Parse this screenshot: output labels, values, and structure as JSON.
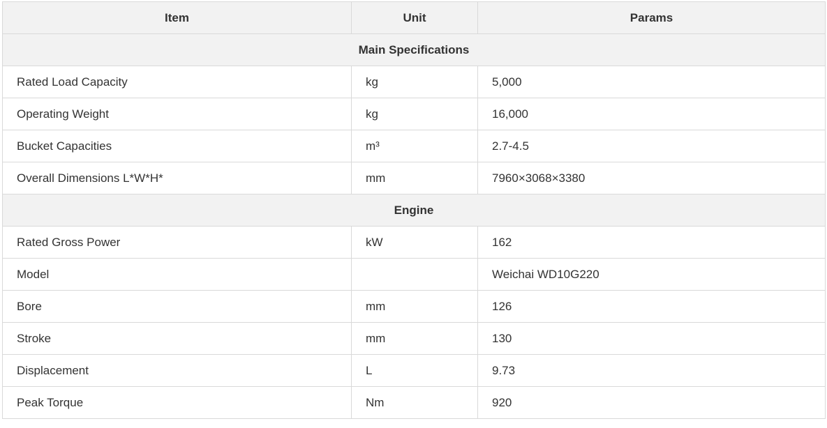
{
  "table": {
    "headers": [
      "Item",
      "Unit",
      "Params"
    ],
    "sections": [
      {
        "title": "Main Specifications",
        "rows": [
          {
            "item": "Rated Load Capacity",
            "unit": "kg",
            "params": "5,000"
          },
          {
            "item": "Operating Weight",
            "unit": "kg",
            "params": "16,000"
          },
          {
            "item": "Bucket Capacities",
            "unit": "m³",
            "params": "2.7-4.5"
          },
          {
            "item": "Overall Dimensions L*W*H*",
            "unit": "mm",
            "params": "7960×3068×3380"
          }
        ]
      },
      {
        "title": "Engine",
        "rows": [
          {
            "item": "Rated Gross Power",
            "unit": "kW",
            "params": "162"
          },
          {
            "item": "Model",
            "unit": "",
            "params": "Weichai WD10G220"
          },
          {
            "item": "Bore",
            "unit": "mm",
            "params": "126"
          },
          {
            "item": "Stroke",
            "unit": "mm",
            "params": "130"
          },
          {
            "item": "Displacement",
            "unit": "L",
            "params": "9.73"
          },
          {
            "item": "Peak Torque",
            "unit": "Nm",
            "params": "920"
          }
        ]
      }
    ]
  }
}
